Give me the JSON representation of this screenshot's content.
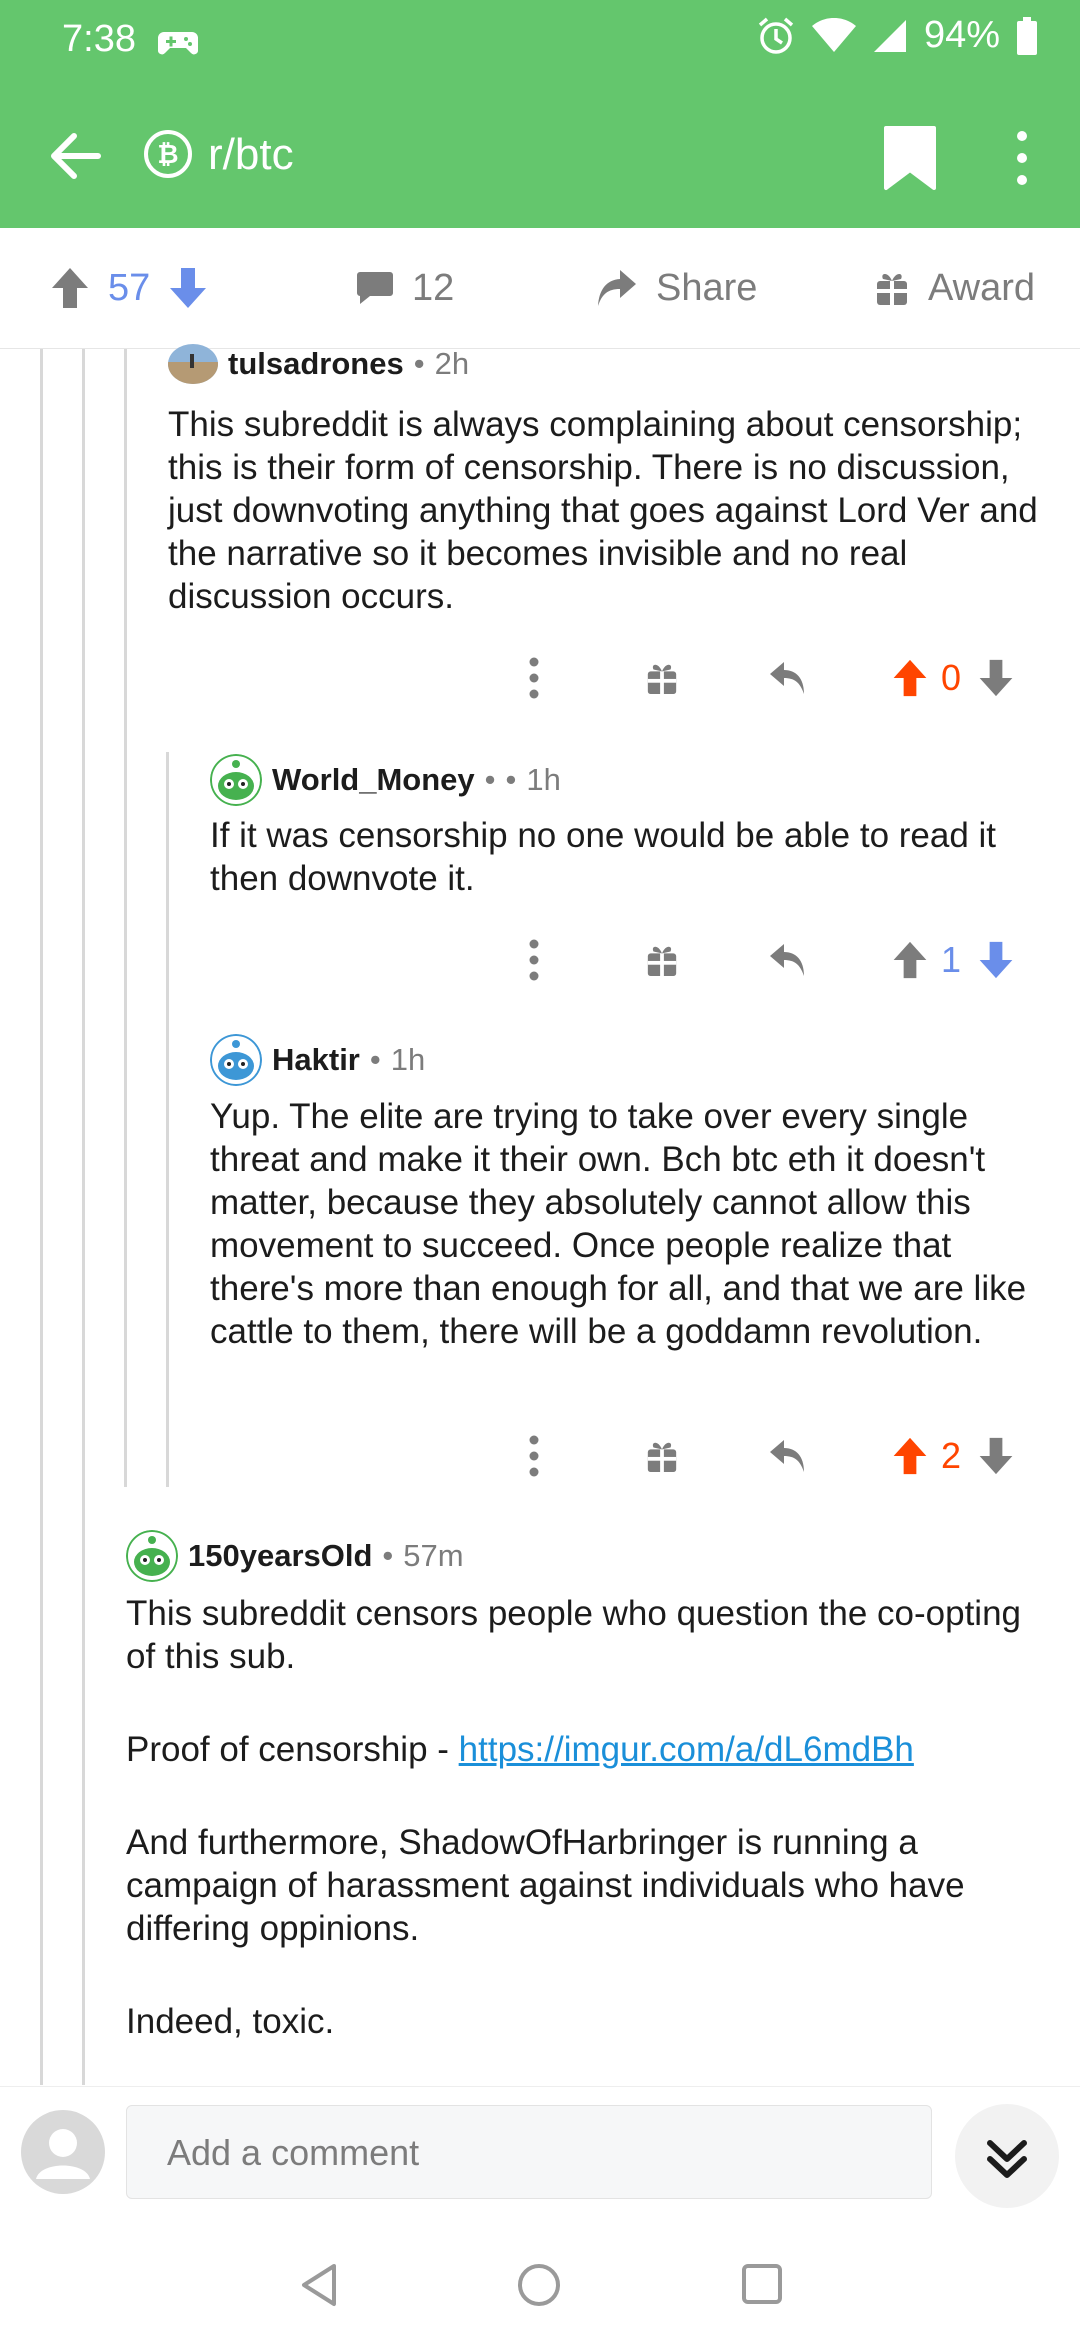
{
  "status_bar": {
    "time": "7:38",
    "battery": "94%"
  },
  "app_bar": {
    "subreddit": "r/btc",
    "subreddit_icon": "bitcoin-icon"
  },
  "post_actions": {
    "score": "57",
    "comments": "12",
    "share_label": "Share",
    "award_label": "Award"
  },
  "comments": [
    {
      "author": "tulsadrones",
      "age": "2h",
      "body": "This subreddit is always complaining about censorship; this is their form of censorship. There is no discussion, just downvoting anything that goes against Lord Ver and the narrative so it becomes invisible and no real discussion occurs.",
      "score": "0",
      "vote_state": "upvoted"
    },
    {
      "author": "World_Money",
      "flair_sep": "•",
      "age": "1h",
      "body": "If it was censorship no one would be able to read it then downvote it.",
      "score": "1",
      "vote_state": "downvoted"
    },
    {
      "author": "Haktir",
      "age": "1h",
      "body": "Yup. The elite are trying to take over every single threat and make it their own. Bch btc eth it doesn't matter, because they absolutely cannot allow this movement to succeed. Once people realize that there's more than enough for all, and that we are like cattle to them, there will be a goddamn revolution.",
      "score": "2",
      "vote_state": "upvoted"
    },
    {
      "author": "150yearsOld",
      "age": "57m",
      "paragraphs": [
        "This subreddit censors people who question the co-opting of this sub.",
        "And furthermore, ShadowOfHarbringer is running a campaign of harassment against individuals who have differing oppinions.",
        "Indeed, toxic."
      ],
      "proof_prefix": "Proof of censorship - ",
      "proof_link": "https://imgur.com/a/dL6mdBh"
    }
  ],
  "comment_bar": {
    "placeholder": "Add a comment"
  },
  "colors": {
    "header_green": "#64c66d",
    "upvote_orange": "#ff4500",
    "downvote_blue": "#6a8eea",
    "link_blue": "#1a8fd9"
  },
  "icons": [
    "back-arrow-icon",
    "bookmark-icon",
    "more-vertical-icon",
    "upvote-icon",
    "downvote-icon",
    "comment-icon",
    "share-icon",
    "gift-icon",
    "reply-icon",
    "avatar-icon",
    "expand-down-icon",
    "nav-back-icon",
    "nav-home-icon",
    "nav-recents-icon"
  ]
}
